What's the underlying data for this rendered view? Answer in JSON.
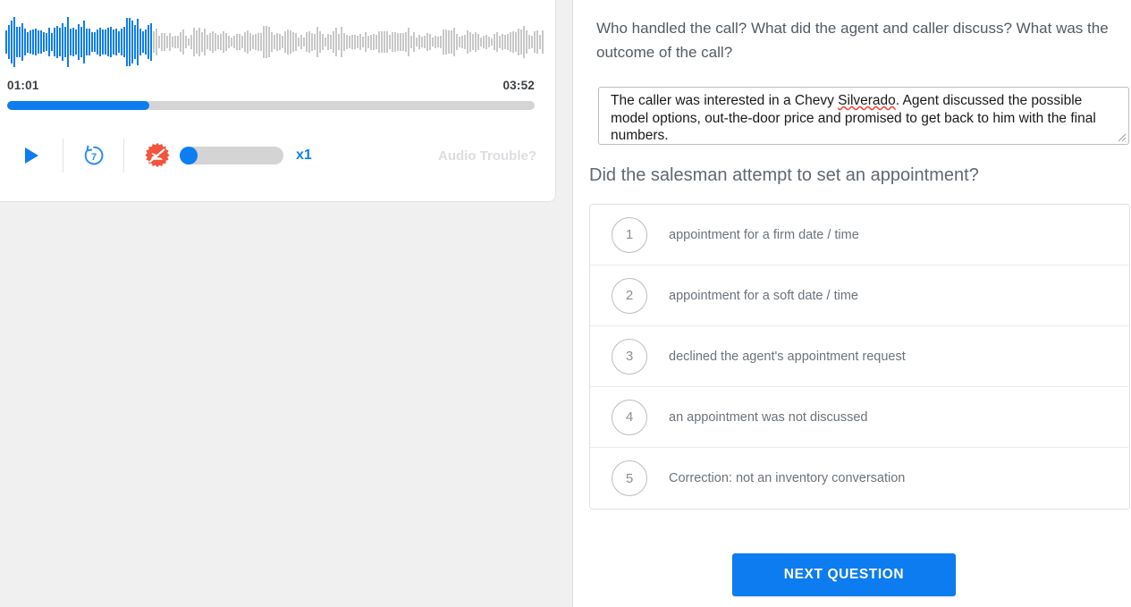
{
  "player": {
    "current_time": "01:01",
    "total_time": "03:52",
    "progress_percent": 27,
    "play_icon": "play-triangle-icon",
    "rewind_icon": "rewind-circle-icon",
    "rewind_seconds": "7",
    "speed_badge_icon": "no-running-shoe-icon",
    "speed_label": "x1",
    "speed_slider_percent": 0,
    "audio_trouble_label": "Audio Trouble?",
    "accent_blue": "#0d7ef2",
    "badge_red": "#f4543c",
    "waveform_played_color": "#0b7ded",
    "waveform_unplayed_color": "#c8c8c8",
    "waveform_played_fraction": 0.27
  },
  "question_one": {
    "prompt": "Who handled the call? What did the agent and caller discuss? What was the outcome of the call?",
    "answer_before_spellcheck": "The caller was interested in a Chevy ",
    "answer_spellcheck_word": "Silverado",
    "answer_after_spellcheck": ". Agent discussed the possible model options, out-the-door price and promised to get back to him with the final numbers.",
    "answer_full": "The caller was interested in a Chevy Silverado. Agent discussed the possible model options, out-the-door price and promised to get back to him with the final numbers.",
    "placeholder": ""
  },
  "question_two": {
    "prompt": "Did the salesman attempt to set an appointment?",
    "options": [
      {
        "number": "1",
        "label": "appointment for a firm date / time"
      },
      {
        "number": "2",
        "label": "appointment for a soft date / time"
      },
      {
        "number": "3",
        "label": "declined the agent's appointment request"
      },
      {
        "number": "4",
        "label": "an appointment was not discussed"
      },
      {
        "number": "5",
        "label": "Correction: not an inventory conversation"
      }
    ]
  },
  "footer": {
    "next_button_label": "NEXT QUESTION",
    "next_button_color": "#0c7cf0"
  }
}
